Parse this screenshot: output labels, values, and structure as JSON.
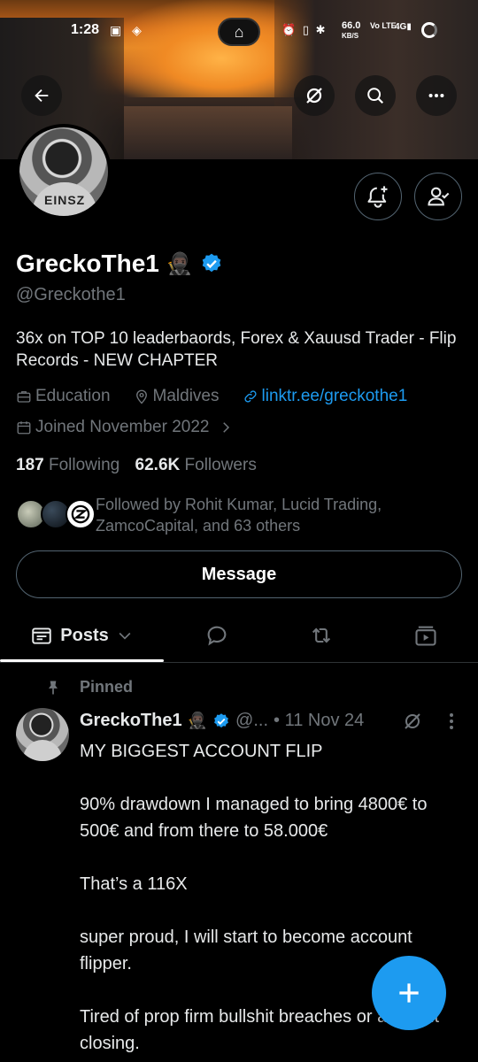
{
  "status_bar": {
    "time": "1:28",
    "network_speed": "66.0",
    "network_speed_unit": "KB/S",
    "network_type": "Vo LTE",
    "signal": "4G"
  },
  "profile": {
    "display_name": "GreckoThe1",
    "name_emoji": "🥷🏿",
    "handle": "@Greckothe1",
    "bio": "36x on TOP 10 leaderbaords, Forex & Xauusd Trader - Flip Records - NEW CHAPTER",
    "category": "Education",
    "location": "Maldives",
    "website": "linktr.ee/greckothe1",
    "joined": "Joined November 2022",
    "following_count": "187",
    "following_label": "Following",
    "followers_count": "62.6K",
    "followers_label": "Followers",
    "followed_by": "Followed by Rohit Kumar, Lucid Trading, ZamcoCapital, and 63 others",
    "message_label": "Message"
  },
  "tabs": {
    "posts_label": "Posts"
  },
  "pinned_post": {
    "pinned_label": "Pinned",
    "author": "GreckoThe1",
    "author_emoji": "🥷🏿",
    "handle": "@...",
    "date": "• 11 Nov 24",
    "paragraphs": [
      "MY BIGGEST ACCOUNT FLIP",
      "90% drawdown I managed to bring 4800€  to 500€ and from there to 58.000€",
      "That’s a 116X",
      "super proud, I will start to become account flipper.",
      "Tired of prop firm bullshit breaches or account closing."
    ]
  },
  "colors": {
    "accent": "#1d9bf0",
    "muted": "#71767b",
    "border": "#536471"
  }
}
